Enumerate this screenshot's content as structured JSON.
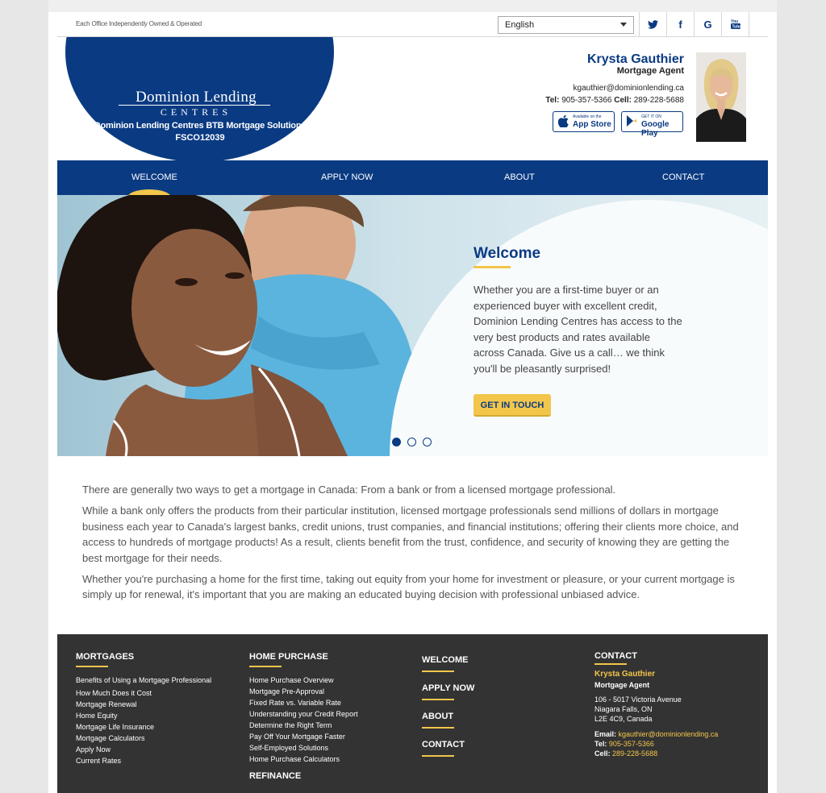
{
  "topbar": {
    "tagline": "Each Office Independently Owned & Operated",
    "language": "English",
    "social_icons": [
      "twitter-icon",
      "facebook-icon",
      "google-icon",
      "youtube-icon"
    ],
    "social_glyphs": [
      "🐦",
      "f",
      "G",
      "You"
    ]
  },
  "header": {
    "logo_word": "Dominion Lending",
    "logo_sub": "CENTRES",
    "office_name": "Dominion Lending Centres BTB Mortgage Solutions",
    "office_license": "FSCO12039",
    "agent_name": "Krysta Gauthier",
    "agent_title": "Mortgage Agent",
    "agent_email": "kgauthier@dominionlending.ca",
    "tel_label": "Tel:",
    "tel": "905-357-5366",
    "cell_label": "Cell:",
    "cell": "289-228-5688",
    "app_store_small": "Available on the",
    "app_store": "App Store",
    "google_play_small": "GET IT ON",
    "google_play": "Google Play"
  },
  "nav": {
    "items": [
      "WELCOME",
      "APPLY NOW",
      "ABOUT",
      "CONTACT"
    ]
  },
  "hero": {
    "title": "Welcome",
    "body": "Whether you are a first-time buyer or an experienced buyer with excellent credit, Dominion Lending Centres has access to the very best products and rates available across Canada. Give us a call… we think you'll be pleasantly surprised!",
    "cta": "GET IN TOUCH",
    "slides": 3,
    "active_slide": 1
  },
  "content": {
    "p1": "There are generally two ways to get a mortgage in Canada: From a bank or from a licensed mortgage professional.",
    "p2": "While a bank only offers the products from their particular institution, licensed mortgage professionals send millions of dollars in mortgage business each year to Canada's largest banks, credit unions, trust companies, and financial institutions; offering their clients more choice, and access to hundreds of mortgage products! As a result, clients benefit from the trust, confidence, and security of knowing they are getting the best mortgage for their needs.",
    "p3": "Whether you're purchasing a home for the first time, taking out equity from your home for investment or pleasure, or your current mortgage is simply up for renewal, it's important that you are making an educated buying decision with professional unbiased advice."
  },
  "footer": {
    "mortgages": {
      "title": "MORTGAGES",
      "items": [
        "Benefits of Using a Mortgage Professional",
        "How Much Does it Cost",
        "Mortgage Renewal",
        "Home Equity",
        "Mortgage Life Insurance",
        "Mortgage Calculators",
        "Apply Now",
        "Current Rates"
      ]
    },
    "home_purchase": {
      "title": "HOME PURCHASE",
      "items": [
        "Home Purchase Overview",
        "Mortgage Pre-Approval",
        "Fixed Rate vs. Variable Rate",
        "Understanding your Credit Report",
        "Determine the Right Term",
        "Pay Off Your Mortgage Faster",
        "Self-Employed Solutions",
        "Home Purchase Calculators"
      ],
      "next_title": "REFINANCE"
    },
    "nav": [
      "WELCOME",
      "APPLY NOW",
      "ABOUT",
      "CONTACT"
    ],
    "contact": {
      "title": "CONTACT",
      "name": "Krysta Gauthier",
      "role": "Mortgage Agent",
      "address1": "106 - 5017 Victoria Avenue",
      "address2": "Niagara Falls, ON",
      "address3": "L2E 4C9, Canada",
      "email_label": "Email:",
      "email": "kgauthier@dominionlending.ca",
      "tel_label": "Tel:",
      "tel": "905-357-5366",
      "cell_label": "Cell:",
      "cell": "289-228-5688"
    }
  },
  "colors": {
    "brand_blue": "#0a3a82",
    "accent_yellow": "#f2c64b",
    "footer_bg": "#333333"
  }
}
